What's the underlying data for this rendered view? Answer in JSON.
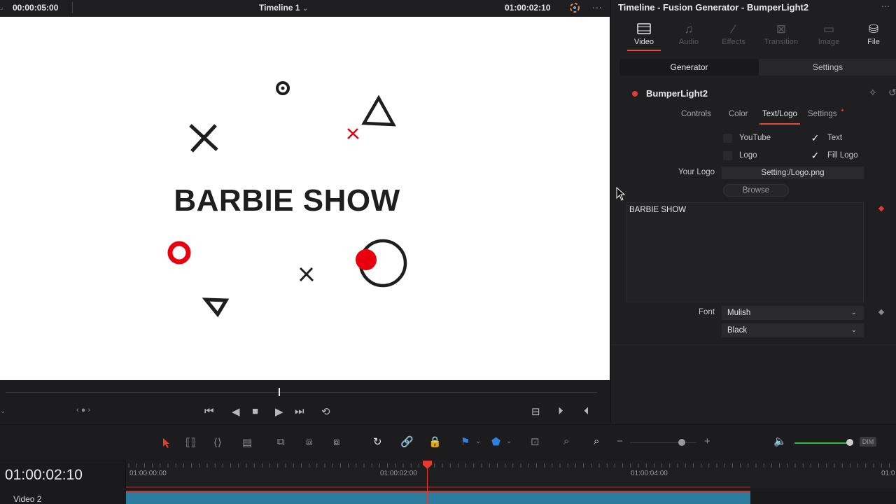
{
  "viewer": {
    "duration": "00:00:05:00",
    "timeline_name": "Timeline 1",
    "current_tc": "01:00:02:10",
    "headline": "BARBIE SHOW"
  },
  "inspector": {
    "title": "Timeline - Fusion Generator - BumperLight2",
    "tabs": [
      "Video",
      "Audio",
      "Effects",
      "Transition",
      "Image",
      "File"
    ],
    "active_tab": "Video",
    "subtabs": [
      "Generator",
      "Settings"
    ],
    "generator_name": "BumperLight2",
    "panel_tabs": [
      "Controls",
      "Color",
      "Text/Logo",
      "Settings"
    ],
    "active_panel_tab": "Text/Logo",
    "options": {
      "youtube_label": "YouTube",
      "text_label": "Text",
      "logo_label": "Logo",
      "fill_logo_label": "Fill Logo"
    },
    "your_logo_label": "Your Logo",
    "your_logo_value": "Setting:/Logo.png",
    "browse_label": "Browse",
    "text_content": "BARBIE SHOW",
    "font_label": "Font",
    "font_value": "Mulish",
    "font_style": "Black"
  },
  "toolbar": {
    "dim_label": "DIM"
  },
  "timeline": {
    "current_tc": "01:00:02:10",
    "ruler_labels": [
      "01:00:00:00",
      "01:00:02:00",
      "01:00:04:00",
      "01:0"
    ],
    "track_label": "Video 2"
  },
  "colors": {
    "accent": "#e64b3c",
    "clip": "#2b7c9e",
    "shape_red": "#e8000f",
    "shape_dark": "#1e1e1e"
  }
}
